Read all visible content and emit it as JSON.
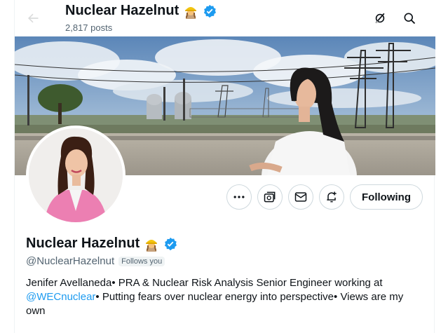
{
  "header": {
    "display_name": "Nuclear Hazelnut",
    "posts_count": "2,817 posts"
  },
  "profile": {
    "display_name": "Nuclear Hazelnut",
    "handle": "@NuclearHazelnut",
    "follows_you": "Follows you",
    "bio_part1": "Jenifer Avellaneda• PRA & Nuclear Risk Analysis Senior Engineer working at ",
    "bio_mention": "@WECnuclear",
    "bio_part2": "• Putting fears over nuclear energy into perspective• Views are my own"
  },
  "actions": {
    "following_label": "Following"
  },
  "icons": {
    "back": "arrow-left-icon",
    "grok": "grok-icon",
    "search": "search-icon",
    "more": "more-dots-icon",
    "subscribe": "subscribe-icon",
    "message": "envelope-icon",
    "notify": "bell-plus-icon",
    "verified": "verified-badge-icon",
    "emoji": "woman-construction-worker-emoji"
  },
  "colors": {
    "accent": "#1d9bf0",
    "text_secondary": "#536471",
    "border": "#cfd9de"
  }
}
